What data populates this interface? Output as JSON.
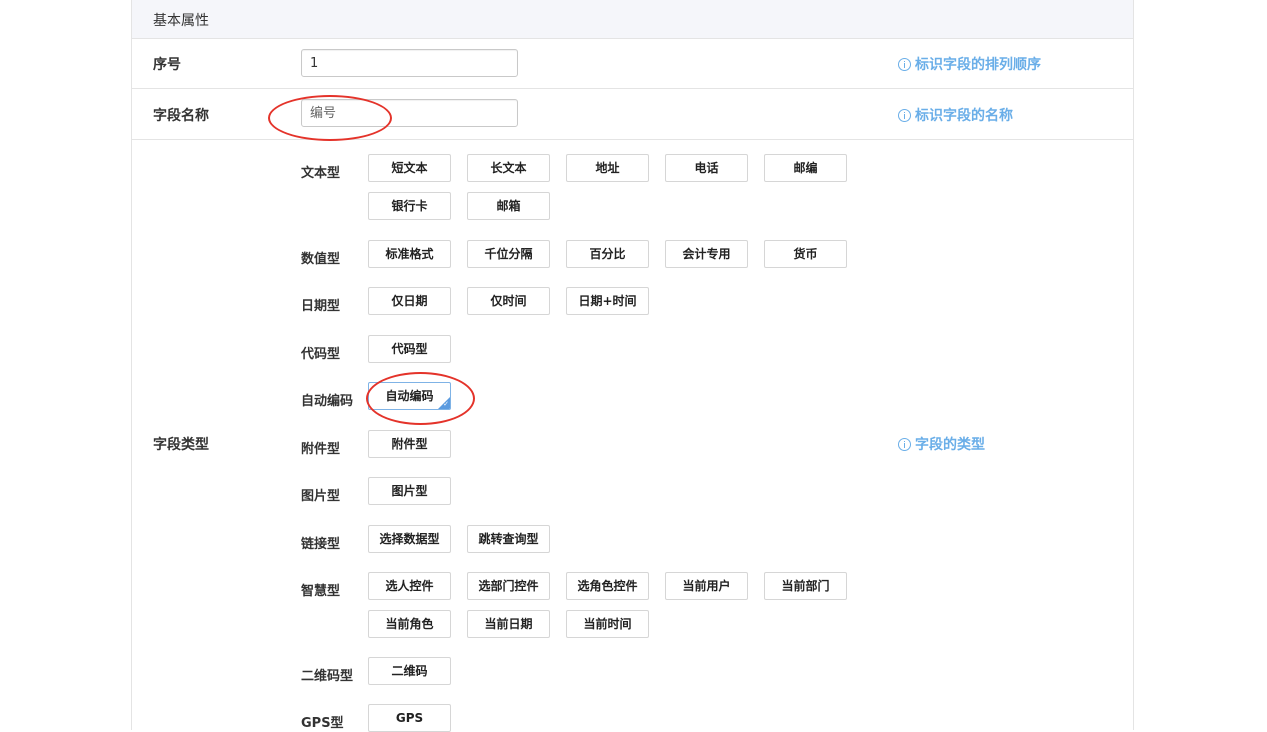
{
  "section": {
    "title": "基本属性"
  },
  "serial": {
    "label": "序号",
    "value": "1",
    "hint": "标识字段的排列顺序"
  },
  "field_name": {
    "label": "字段名称",
    "placeholder": "编号",
    "hint": "标识字段的名称"
  },
  "field_type": {
    "label": "字段类型",
    "hint": "字段的类型",
    "selected": "自动编码",
    "categories": [
      {
        "label": "文本型",
        "options": [
          "短文本",
          "长文本",
          "地址",
          "电话",
          "邮编",
          "银行卡",
          "邮箱"
        ]
      },
      {
        "label": "数值型",
        "options": [
          "标准格式",
          "千位分隔",
          "百分比",
          "会计专用",
          "货币"
        ]
      },
      {
        "label": "日期型",
        "options": [
          "仅日期",
          "仅时间",
          "日期+时间"
        ]
      },
      {
        "label": "代码型",
        "options": [
          "代码型"
        ]
      },
      {
        "label": "自动编码",
        "options": [
          "自动编码"
        ]
      },
      {
        "label": "附件型",
        "options": [
          "附件型"
        ]
      },
      {
        "label": "图片型",
        "options": [
          "图片型"
        ]
      },
      {
        "label": "链接型",
        "options": [
          "选择数据型",
          "跳转查询型"
        ]
      },
      {
        "label": "智慧型",
        "options": [
          "选人控件",
          "选部门控件",
          "选角色控件",
          "当前用户",
          "当前部门",
          "当前角色",
          "当前日期",
          "当前时间"
        ]
      },
      {
        "label": "二维码型",
        "options": [
          "二维码"
        ]
      },
      {
        "label": "GPS型",
        "options": [
          "GPS"
        ]
      }
    ]
  },
  "colors": {
    "hint": "#6aaee8",
    "annotation": "#e4332a",
    "selected": "#5b9be0"
  }
}
